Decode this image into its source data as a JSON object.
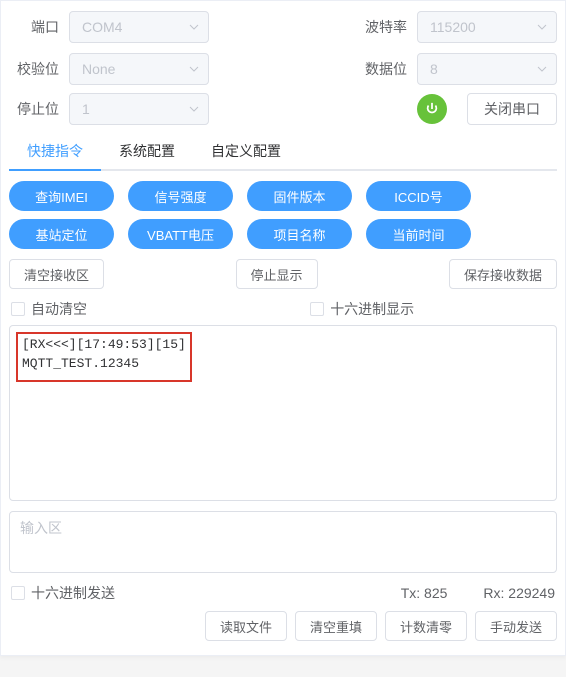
{
  "labels": {
    "port": "端口",
    "baud": "波特率",
    "parity": "校验位",
    "databits": "数据位",
    "stopbits": "停止位"
  },
  "values": {
    "port": "COM4",
    "baud": "115200",
    "parity": "None",
    "databits": "8",
    "stopbits": "1"
  },
  "close_port": "关闭串口",
  "tabs": {
    "quick": "快捷指令",
    "system": "系统配置",
    "custom": "自定义配置"
  },
  "cmds": {
    "imei": "查询IMEI",
    "signal": "信号强度",
    "fw": "固件版本",
    "iccid": "ICCID号",
    "lbs": "基站定位",
    "vbatt": "VBATT电压",
    "proj": "项目名称",
    "time": "当前时间"
  },
  "actions": {
    "clear_rx": "清空接收区",
    "stop_disp": "停止显示",
    "save_rx": "保存接收数据"
  },
  "options": {
    "auto_clear": "自动清空",
    "hex_disp": "十六进制显示",
    "hex_send": "十六进制发送"
  },
  "output": {
    "line1": "[RX<<<][17:49:53][15]",
    "line2": "MQTT_TEST.12345"
  },
  "input_placeholder": "输入区",
  "stats": {
    "tx_label": "Tx:",
    "tx": "825",
    "rx_label": "Rx:",
    "rx": "229249"
  },
  "bottom": {
    "read_file": "读取文件",
    "clear_fill": "清空重填",
    "counter_reset": "计数清零",
    "manual_send": "手动发送"
  }
}
